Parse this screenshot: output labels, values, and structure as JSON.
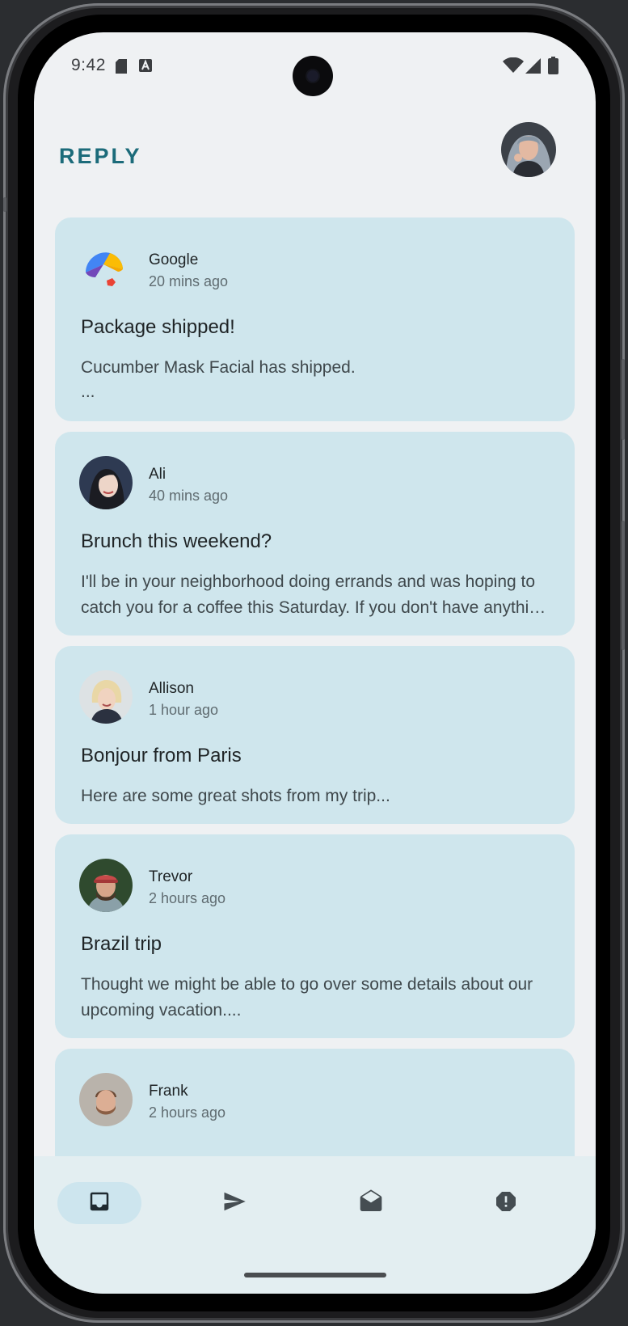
{
  "status_bar": {
    "time": "9:42",
    "left_icons": [
      "sd-card-icon",
      "text-a-icon"
    ],
    "right_icons": [
      "wifi-icon",
      "signal-icon",
      "battery-icon"
    ]
  },
  "app": {
    "title": "REPLY",
    "accent_color": "#1c6b7a",
    "card_color": "#cfe6ed"
  },
  "emails": [
    {
      "sender": "Google",
      "time": "20 mins ago",
      "subject": "Package shipped!",
      "preview": "Cucumber Mask Facial has shipped.",
      "preview_more": "...",
      "avatar": "google-umbrella-logo"
    },
    {
      "sender": "Ali",
      "time": "40 mins ago",
      "subject": "Brunch this weekend?",
      "preview": "I'll be in your neighborhood doing errands and was hoping to catch you for a coffee this Saturday. If you don't have anything scheduled, it would be great to see you.",
      "avatar": "ali-avatar"
    },
    {
      "sender": "Allison",
      "time": "1 hour ago",
      "subject": "Bonjour from Paris",
      "preview": "Here are some great shots from my trip...",
      "avatar": "allison-avatar"
    },
    {
      "sender": "Trevor",
      "time": "2 hours ago",
      "subject": "Brazil trip",
      "preview": "Thought we might be able to go over some details about our upcoming vacation....",
      "avatar": "trevor-avatar"
    },
    {
      "sender": "Frank",
      "time": "2 hours ago",
      "subject": "",
      "preview": "",
      "avatar": "frank-avatar"
    }
  ],
  "bottom_nav": [
    {
      "icon": "inbox-icon",
      "active": true
    },
    {
      "icon": "send-icon",
      "active": false
    },
    {
      "icon": "drafts-icon",
      "active": false
    },
    {
      "icon": "report-icon",
      "active": false
    }
  ]
}
